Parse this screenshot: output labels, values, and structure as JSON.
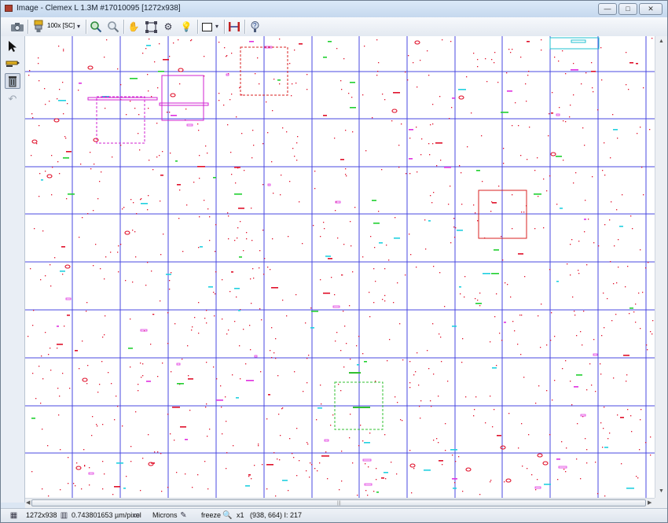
{
  "window": {
    "title": "Image - Clemex L 1.3M #17010095 [1272x938]",
    "controls": {
      "minimize": "—",
      "maximize": "□",
      "close": "✕"
    }
  },
  "toolbar": {
    "objective_label": "100x [SC]",
    "icons": [
      "camera-icon",
      "objective-icon",
      "dropdown-icon",
      "zoom-in-icon",
      "zoom-out-icon",
      "pan-hand-icon",
      "fit-image-icon",
      "settings-gear-icon",
      "lightbulb-icon",
      "rectangle-shape-icon",
      "dropdown-icon",
      "measure-calipers-icon",
      "help-icon"
    ]
  },
  "left_tools": [
    "pointer-arrow-icon",
    "pencil-icon",
    "trash-icon",
    "undo-icon"
  ],
  "status": {
    "image_size": "1272x938",
    "calibration": "0.743801653 µm/pixel",
    "units": "Microns",
    "mode": "freeze",
    "zoom": "x1",
    "cursor": "(938, 664) I: 217"
  },
  "colors": {
    "grid": "#4848e0",
    "particle_red": "#e0102a",
    "particle_magenta": "#e030e0",
    "particle_cyan": "#20d0e0",
    "particle_green": "#20d030",
    "box_red": "#d82020",
    "box_magenta": "#d020d0",
    "box_green": "#30c030",
    "box_cyan": "#20c0d0"
  }
}
